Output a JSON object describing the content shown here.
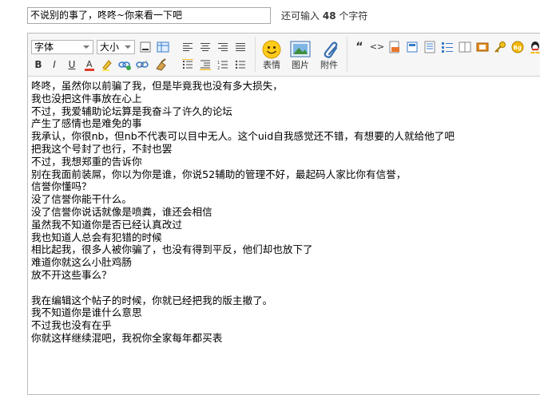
{
  "title_field": {
    "value": "不说别的事了，咚咚~你来看一下吧"
  },
  "char_counter": {
    "prefix": "还可输入",
    "count": "48",
    "suffix": "个字符"
  },
  "toolbar": {
    "font_select": "字体",
    "size_select": "大小",
    "emoticon_label": "表情",
    "image_label": "图片",
    "attachment_label": "附件",
    "bold": "B",
    "italic": "I",
    "underline": "U",
    "quote": "“",
    "code": "<>"
  },
  "post_lines": [
    "咚咚，虽然你以前骗了我，但是毕竟我也没有多大损失，",
    "我也没把这件事放在心上",
    "不过，我爱辅助论坛算是我奋斗了许久的论坛",
    "产生了感情也是难免的事",
    "我承认，你很nb，但nb不代表可以目中无人。这个uid自我感觉还不错，有想要的人就给他了吧",
    "把我这个号封了也行，不封也罢",
    "不过，我想郑重的告诉你",
    "别在我面前装屌，你以为你是谁，你说52辅助的管理不好，最起码人家比你有信誉，",
    "信誉你懂吗？",
    "没了信誉你能干什么。",
    "没了信誉你说话就像是喷粪，谁还会相信",
    "虽然我不知道你是否已经认真改过",
    "我也知道人总会有犯错的时候",
    "相比起我，很多人被你骗了，也没有得到平反，他们却也放下了",
    "难道你就这么小肚鸡肠",
    "放不开这些事么？",
    "",
    "我在编辑这个帖子的时候，你就已经把我的版主撤了。",
    "我不知道你是谁什么意思",
    "不过我也没有在乎",
    "你就这样继续混吧，我祝你全家每年都买表"
  ]
}
